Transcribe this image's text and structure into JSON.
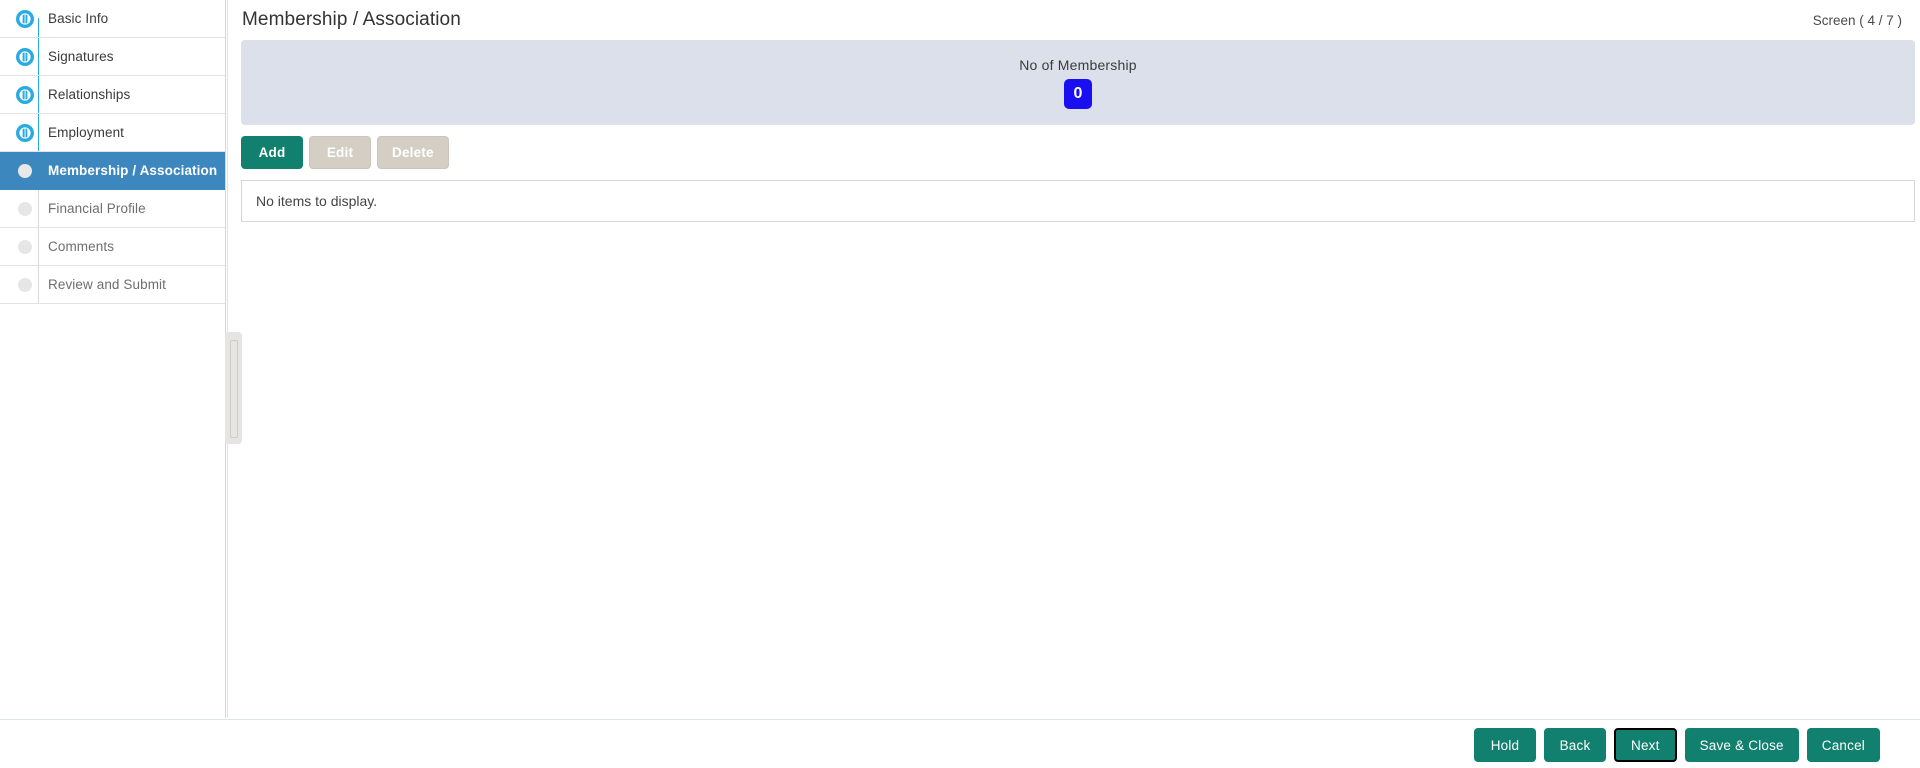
{
  "header": {
    "title": "Membership / Association",
    "screen_indicator": "Screen ( 4 / 7 )"
  },
  "wizard": {
    "steps": [
      {
        "label": "Basic Info",
        "state": "done",
        "icon": "step-complete-icon"
      },
      {
        "label": "Signatures",
        "state": "done",
        "icon": "step-complete-icon"
      },
      {
        "label": "Relationships",
        "state": "done",
        "icon": "step-complete-icon"
      },
      {
        "label": "Employment",
        "state": "done",
        "icon": "step-complete-icon"
      },
      {
        "label": "Membership / Association",
        "state": "current",
        "icon": "step-current-icon"
      },
      {
        "label": "Financial Profile",
        "state": "pending",
        "icon": "step-pending-icon"
      },
      {
        "label": "Comments",
        "state": "pending",
        "icon": "step-pending-icon"
      },
      {
        "label": "Review and Submit",
        "state": "pending",
        "icon": "step-pending-icon"
      }
    ]
  },
  "summary": {
    "label": "No of Membership",
    "count": "0",
    "badge_color": "#1a0ff0",
    "band_color": "#dbe0ea"
  },
  "toolbar": {
    "add_label": "Add",
    "edit_label": "Edit",
    "delete_label": "Delete"
  },
  "grid": {
    "empty_text": "No items to display."
  },
  "footer": {
    "hold_label": "Hold",
    "back_label": "Back",
    "next_label": "Next",
    "save_close_label": "Save & Close",
    "cancel_label": "Cancel"
  },
  "colors": {
    "accent_teal": "#11806f",
    "selected_blue": "#3d87bf",
    "step_cyan": "#29abe2"
  }
}
